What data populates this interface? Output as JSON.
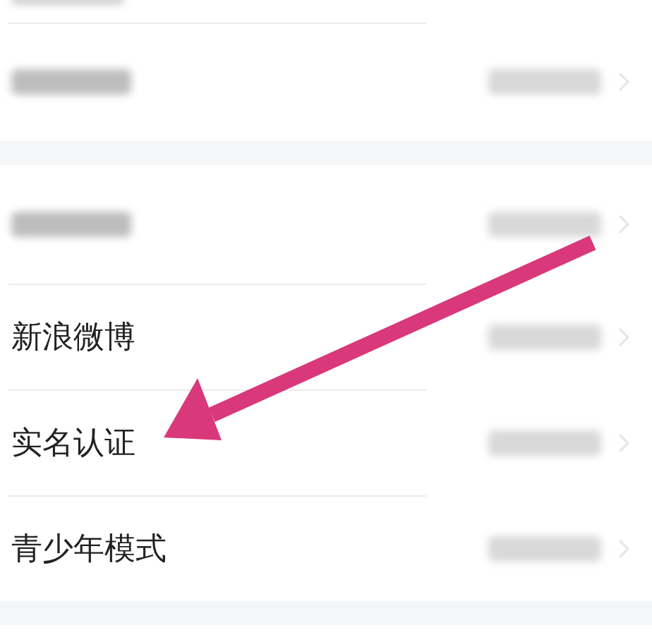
{
  "groups": [
    {
      "rows": [
        {
          "kind": "cut"
        },
        {
          "kind": "blurred"
        }
      ]
    },
    {
      "rows": [
        {
          "kind": "blurred"
        },
        {
          "kind": "label",
          "label": "新浪微博"
        },
        {
          "kind": "label",
          "label": "实名认证"
        },
        {
          "kind": "label",
          "label": "青少年模式"
        }
      ]
    }
  ]
}
